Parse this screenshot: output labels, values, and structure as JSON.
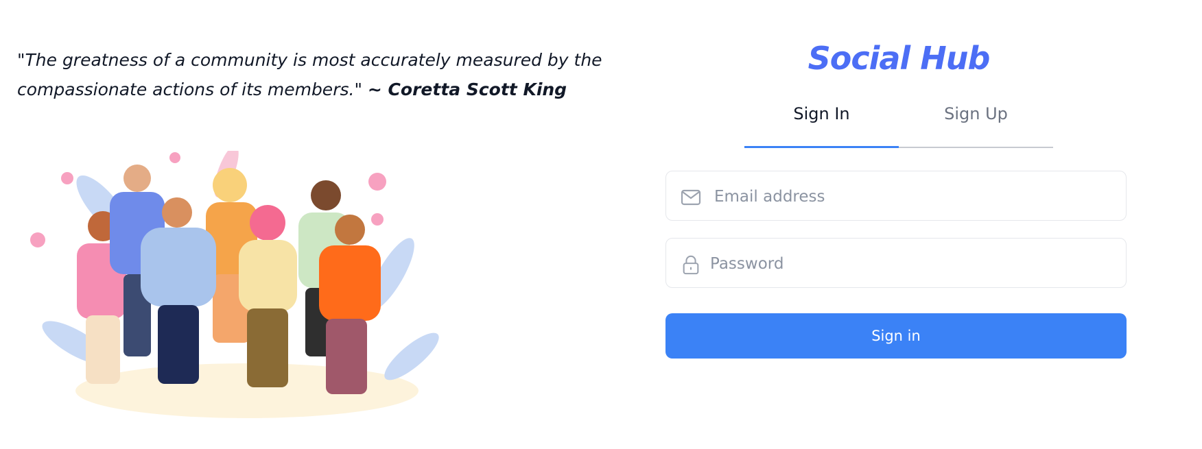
{
  "quote": {
    "text": "\"The greatness of a community is most accurately measured by the compassionate actions of its members.\"",
    "author": "~ Coretta Scott King"
  },
  "brand": {
    "name": "Social Hub",
    "color": "#4c6ef5"
  },
  "tabs": [
    {
      "label": "Sign In",
      "active": true
    },
    {
      "label": "Sign Up",
      "active": false
    }
  ],
  "form": {
    "email": {
      "placeholder": "Email address",
      "value": "",
      "icon": "mail-icon"
    },
    "password": {
      "placeholder": "Password",
      "value": "",
      "icon": "lock-icon"
    },
    "submit_label": "Sign in"
  },
  "colors": {
    "accent": "#3b82f6",
    "tab_divider": "#c7cad1"
  },
  "illustration": {
    "subject": "group-of-diverse-people-hugging"
  }
}
